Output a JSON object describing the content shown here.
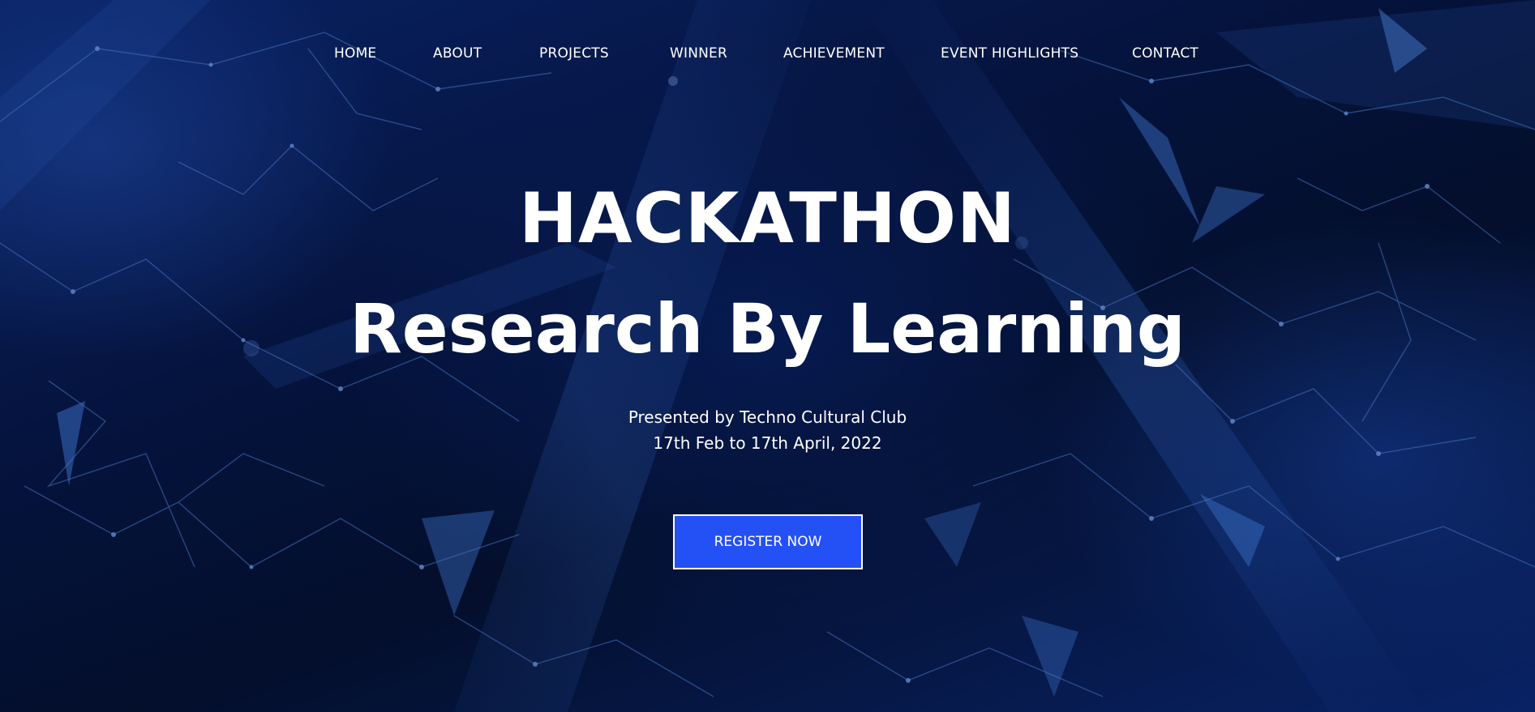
{
  "nav": {
    "items": [
      {
        "label": "HOME"
      },
      {
        "label": "ABOUT"
      },
      {
        "label": "PROJECTS"
      },
      {
        "label": "WINNER"
      },
      {
        "label": "ACHIEVEMENT"
      },
      {
        "label": "EVENT HIGHLIGHTS"
      },
      {
        "label": "CONTACT"
      }
    ]
  },
  "hero": {
    "title": "HACKATHON",
    "subtitle": "Research By Learning",
    "presented_by": "Presented by Techno Cultural Club",
    "dates": "17th Feb to 17th April, 2022",
    "register_label": "REGISTER NOW"
  },
  "colors": {
    "background": "#05102e",
    "accent_button": "#2451f5",
    "text": "#ffffff"
  }
}
